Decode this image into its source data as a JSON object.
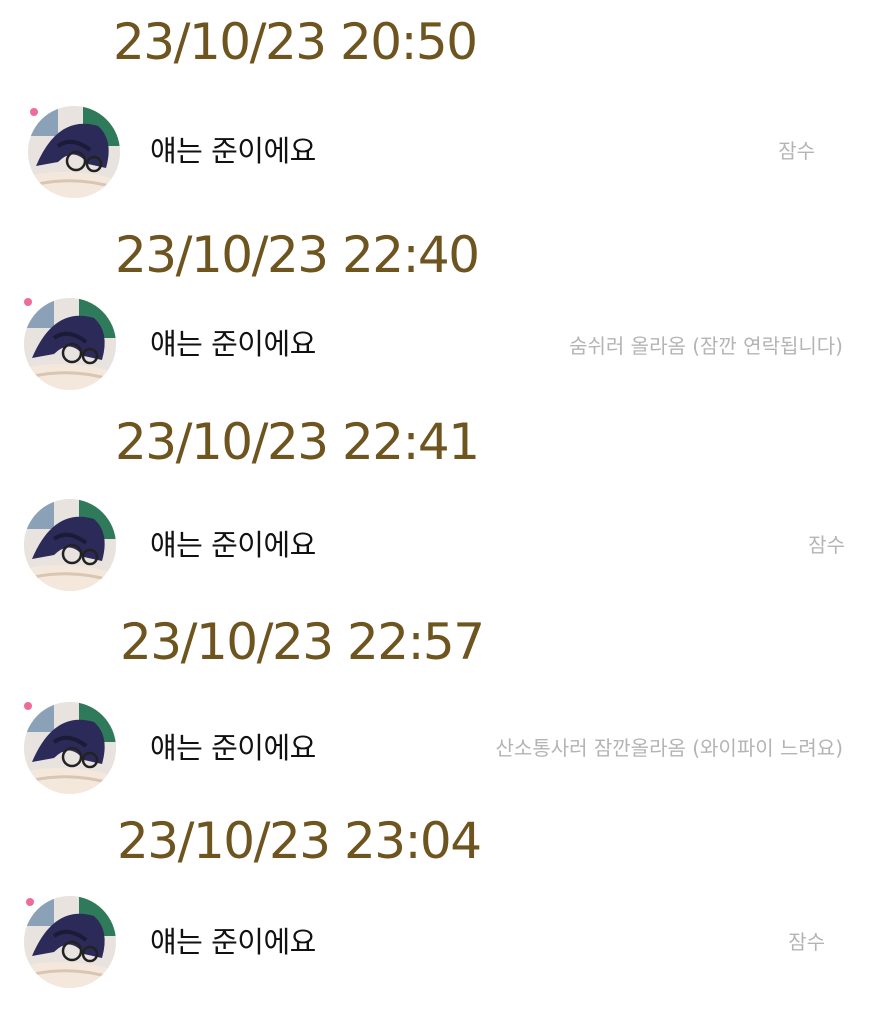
{
  "colors": {
    "timestamp": "#6e5520",
    "name": "#111111",
    "status": "#b4b4b4",
    "unread_dot": "#f06b9a"
  },
  "entries": [
    {
      "timestamp": "23/10/23 20:50",
      "name": "얘는 준이에요",
      "status": "잠수",
      "unread_dot": true,
      "avatar_icon": "profile-avatar"
    },
    {
      "timestamp": "23/10/23 22:40",
      "name": "얘는 준이에요",
      "status": "숨쉬러 올라옴 (잠깐 연락됩니다)",
      "unread_dot": true,
      "avatar_icon": "profile-avatar"
    },
    {
      "timestamp": "23/10/23 22:41",
      "name": "얘는 준이에요",
      "status": "잠수",
      "unread_dot": false,
      "avatar_icon": "profile-avatar"
    },
    {
      "timestamp": "23/10/23 22:57",
      "name": "얘는 준이에요",
      "status": "산소통사러 잠깐올라옴 (와이파이 느려요)",
      "unread_dot": true,
      "avatar_icon": "profile-avatar"
    },
    {
      "timestamp": "23/10/23 23:04",
      "name": "얘는 준이에요",
      "status": "잠수",
      "unread_dot": true,
      "avatar_icon": "profile-avatar"
    }
  ]
}
